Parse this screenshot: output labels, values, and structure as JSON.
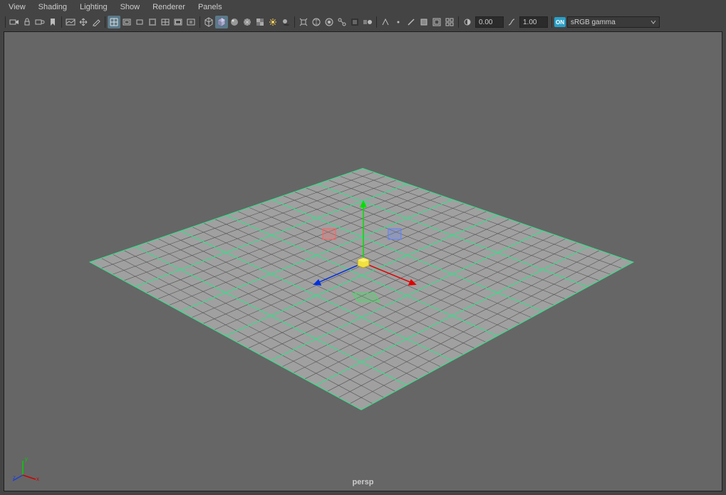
{
  "menubar": {
    "items": [
      "View",
      "Shading",
      "Lighting",
      "Show",
      "Renderer",
      "Panels"
    ]
  },
  "toolbar": {
    "exposure": "0.00",
    "gamma": "1.00",
    "on_label": "ON",
    "colorspace": "sRGB gamma"
  },
  "viewport": {
    "camera": "persp",
    "axes": {
      "x": "x",
      "y": "y",
      "z": "z"
    }
  }
}
